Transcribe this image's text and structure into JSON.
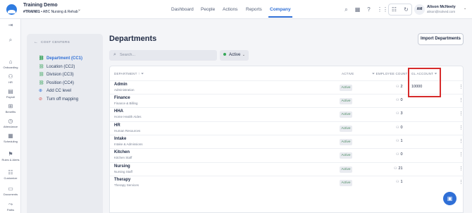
{
  "header": {
    "org_title": "Training Demo",
    "org_code": "#TRAIN01",
    "org_sep": "•",
    "org_name": "ABC Nursing & Rehab",
    "nav": [
      "Dashboard",
      "People",
      "Actions",
      "Reports",
      "Company"
    ],
    "active_nav": "Company",
    "user": {
      "initials": "AM",
      "name": "Alison McNeely",
      "email": "alison@isolved.com"
    }
  },
  "rail": {
    "items": [
      {
        "label": "Onboarding",
        "icon": "onboarding-icon"
      },
      {
        "label": "HR",
        "icon": "hr-icon"
      },
      {
        "label": "Payroll",
        "icon": "payroll-icon"
      },
      {
        "label": "Benefits",
        "icon": "benefits-icon"
      },
      {
        "label": "Attendance",
        "icon": "attendance-icon"
      },
      {
        "label": "Scheduling",
        "icon": "scheduling-icon"
      },
      {
        "label": "Rules & Alerts",
        "icon": "rules-alerts-icon"
      },
      {
        "label": "Customize",
        "icon": "customize-icon"
      },
      {
        "label": "Documents",
        "icon": "documents-icon"
      },
      {
        "label": "Paths",
        "icon": "paths-icon"
      }
    ]
  },
  "cost_centers": {
    "heading": "COST CENTERS",
    "items": [
      {
        "label": "Department (CC1)",
        "active": true
      },
      {
        "label": "Location (CC2)",
        "active": false
      },
      {
        "label": "Division (CC3)",
        "active": false
      },
      {
        "label": "Position (CC4)",
        "active": false
      }
    ],
    "add_label": "Add CC level",
    "off_label": "Turn off mapping"
  },
  "main": {
    "title": "Departments",
    "import_label": "Import Departments",
    "search_placeholder": "Search...",
    "filter_label": "Active"
  },
  "table": {
    "headers": {
      "department": "DEPARTMENT",
      "active": "ACTIVE",
      "employee_count": "EMPLOYEE COUNT",
      "gl_account": "GL ACCOUNT"
    },
    "rows": [
      {
        "name": "Admin",
        "sub": "Administration",
        "status": "Active",
        "count": "2",
        "gl": "10000"
      },
      {
        "name": "Finance",
        "sub": "Finance & Billing",
        "status": "Active",
        "count": "0",
        "gl": ""
      },
      {
        "name": "HHA",
        "sub": "Home Health Aides",
        "status": "Active",
        "count": "3",
        "gl": ""
      },
      {
        "name": "HR",
        "sub": "Human Resources",
        "status": "Active",
        "count": "0",
        "gl": ""
      },
      {
        "name": "Intake",
        "sub": "Intake & Admissions",
        "status": "Active",
        "count": "1",
        "gl": ""
      },
      {
        "name": "Kitchen",
        "sub": "Kitchen Staff",
        "status": "Active",
        "count": "0",
        "gl": ""
      },
      {
        "name": "Nursing",
        "sub": "Nursing Staff",
        "status": "Active",
        "count": "21",
        "gl": ""
      },
      {
        "name": "Therapy",
        "sub": "Therapy Services",
        "status": "Active",
        "count": "1",
        "gl": ""
      }
    ]
  },
  "colors": {
    "accent": "#2f6fd6",
    "highlight": "#d62b2b",
    "active_dot": "#36a85a"
  }
}
